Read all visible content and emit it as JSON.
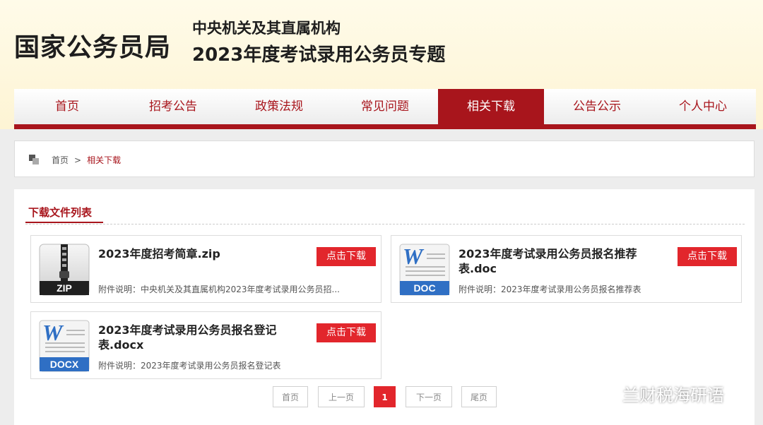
{
  "header": {
    "brand": "国家公务员局",
    "subtitle_line1": "中央机关及其直属机构",
    "subtitle_line2": "2023年度考试录用公务员专题"
  },
  "nav": {
    "items": [
      "首页",
      "招考公告",
      "政策法规",
      "常见问题",
      "相关下载",
      "公告公示",
      "个人中心"
    ],
    "active_index": 4
  },
  "breadcrumb": {
    "home": "首页",
    "separator": ">",
    "current": "相关下载"
  },
  "section": {
    "title": "下载文件列表"
  },
  "files": [
    {
      "icon": "zip-file-icon",
      "badge": "ZIP",
      "title": "2023年度招考简章.zip",
      "desc": "附件说明：中央机关及其直属机构2023年度考试录用公务员招...",
      "button": "点击下载"
    },
    {
      "icon": "doc-file-icon",
      "badge": "DOC",
      "title": "2023年度考试录用公务员报名推荐表.doc",
      "desc": "附件说明：2023年度考试录用公务员报名推荐表",
      "button": "点击下载"
    },
    {
      "icon": "docx-file-icon",
      "badge": "DOCX",
      "title": "2023年度考试录用公务员报名登记表.docx",
      "desc": "附件说明：2023年度考试录用公务员报名登记表",
      "button": "点击下载"
    }
  ],
  "pagination": {
    "first": "首页",
    "prev": "上一页",
    "current": "1",
    "next": "下一页",
    "last": "尾页"
  },
  "watermark": {
    "text": "兰财税海研语"
  },
  "colors": {
    "accent": "#a8151c",
    "button": "#e2262c",
    "doc_blue": "#2f6fc4"
  }
}
